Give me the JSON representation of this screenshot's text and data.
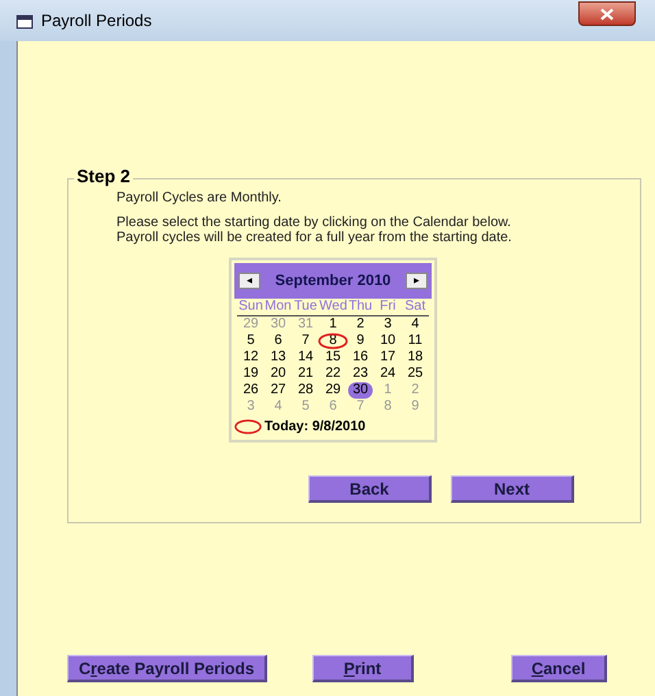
{
  "window": {
    "title": "Payroll Periods"
  },
  "step": {
    "title": "Step 2",
    "lines": [
      "Payroll Cycles are Monthly.",
      "Please select the starting date by clicking on the Calendar below. Payroll cycles will be created for a full year from the starting date."
    ]
  },
  "calendar": {
    "month": "September 2010",
    "prev": "◂",
    "next": "▸",
    "weekdays": [
      "Sun",
      "Mon",
      "Tue",
      "Wed",
      "Thu",
      "Fri",
      "Sat"
    ],
    "weeks": [
      [
        {
          "day": "29",
          "muted": true,
          "selected": false,
          "today": false
        },
        {
          "day": "30",
          "muted": true,
          "selected": false,
          "today": false
        },
        {
          "day": "31",
          "muted": true,
          "selected": false,
          "today": false
        },
        {
          "day": "1",
          "muted": false,
          "selected": false,
          "today": false
        },
        {
          "day": "2",
          "muted": false,
          "selected": false,
          "today": false
        },
        {
          "day": "3",
          "muted": false,
          "selected": false,
          "today": false
        },
        {
          "day": "4",
          "muted": false,
          "selected": false,
          "today": false
        }
      ],
      [
        {
          "day": "5",
          "muted": false,
          "selected": false,
          "today": false
        },
        {
          "day": "6",
          "muted": false,
          "selected": false,
          "today": false
        },
        {
          "day": "7",
          "muted": false,
          "selected": false,
          "today": false
        },
        {
          "day": "8",
          "muted": false,
          "selected": false,
          "today": true
        },
        {
          "day": "9",
          "muted": false,
          "selected": false,
          "today": false
        },
        {
          "day": "10",
          "muted": false,
          "selected": false,
          "today": false
        },
        {
          "day": "11",
          "muted": false,
          "selected": false,
          "today": false
        }
      ],
      [
        {
          "day": "12",
          "muted": false,
          "selected": false,
          "today": false
        },
        {
          "day": "13",
          "muted": false,
          "selected": false,
          "today": false
        },
        {
          "day": "14",
          "muted": false,
          "selected": false,
          "today": false
        },
        {
          "day": "15",
          "muted": false,
          "selected": false,
          "today": false
        },
        {
          "day": "16",
          "muted": false,
          "selected": false,
          "today": false
        },
        {
          "day": "17",
          "muted": false,
          "selected": false,
          "today": false
        },
        {
          "day": "18",
          "muted": false,
          "selected": false,
          "today": false
        }
      ],
      [
        {
          "day": "19",
          "muted": false,
          "selected": false,
          "today": false
        },
        {
          "day": "20",
          "muted": false,
          "selected": false,
          "today": false
        },
        {
          "day": "21",
          "muted": false,
          "selected": false,
          "today": false
        },
        {
          "day": "22",
          "muted": false,
          "selected": false,
          "today": false
        },
        {
          "day": "23",
          "muted": false,
          "selected": false,
          "today": false
        },
        {
          "day": "24",
          "muted": false,
          "selected": false,
          "today": false
        },
        {
          "day": "25",
          "muted": false,
          "selected": false,
          "today": false
        }
      ],
      [
        {
          "day": "26",
          "muted": false,
          "selected": false,
          "today": false
        },
        {
          "day": "27",
          "muted": false,
          "selected": false,
          "today": false
        },
        {
          "day": "28",
          "muted": false,
          "selected": false,
          "today": false
        },
        {
          "day": "29",
          "muted": false,
          "selected": false,
          "today": false
        },
        {
          "day": "30",
          "muted": false,
          "selected": true,
          "today": false
        },
        {
          "day": "1",
          "muted": true,
          "selected": false,
          "today": false
        },
        {
          "day": "2",
          "muted": true,
          "selected": false,
          "today": false
        }
      ],
      [
        {
          "day": "3",
          "muted": true,
          "selected": false,
          "today": false
        },
        {
          "day": "4",
          "muted": true,
          "selected": false,
          "today": false
        },
        {
          "day": "5",
          "muted": true,
          "selected": false,
          "today": false
        },
        {
          "day": "6",
          "muted": true,
          "selected": false,
          "today": false
        },
        {
          "day": "7",
          "muted": true,
          "selected": false,
          "today": false
        },
        {
          "day": "8",
          "muted": true,
          "selected": false,
          "today": false
        },
        {
          "day": "9",
          "muted": true,
          "selected": false,
          "today": false
        }
      ]
    ],
    "today_label": "Today: 9/8/2010"
  },
  "nav_buttons": [
    {
      "after": "Back"
    },
    {
      "after": "Next"
    }
  ],
  "bottom_buttons": [
    {
      "before": "C",
      "key": "r",
      "after": "eate Payroll Periods"
    },
    {
      "key": "P",
      "after": "rint"
    },
    {
      "key": "C",
      "after": "ancel"
    }
  ]
}
